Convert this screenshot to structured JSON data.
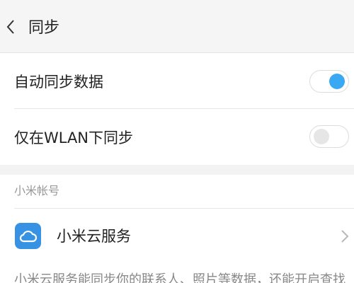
{
  "header": {
    "back_icon": "chevron-left-icon",
    "title": "同步"
  },
  "settings": {
    "auto_sync": {
      "label": "自动同步数据",
      "enabled": true
    },
    "wlan_only": {
      "label": "仅在WLAN下同步",
      "enabled": false
    }
  },
  "account_section": {
    "title": "小米帐号",
    "cloud_item": {
      "icon": "cloud-icon",
      "label": "小米云服务",
      "arrow_icon": "chevron-right-icon"
    },
    "description": "小米云服务能同步你的联系人、照片等数据，还能开启查找"
  },
  "colors": {
    "accent": "#3aa8f2",
    "cloud_icon_bg": "#3792e4",
    "header_bg": "#f5f5f5"
  }
}
